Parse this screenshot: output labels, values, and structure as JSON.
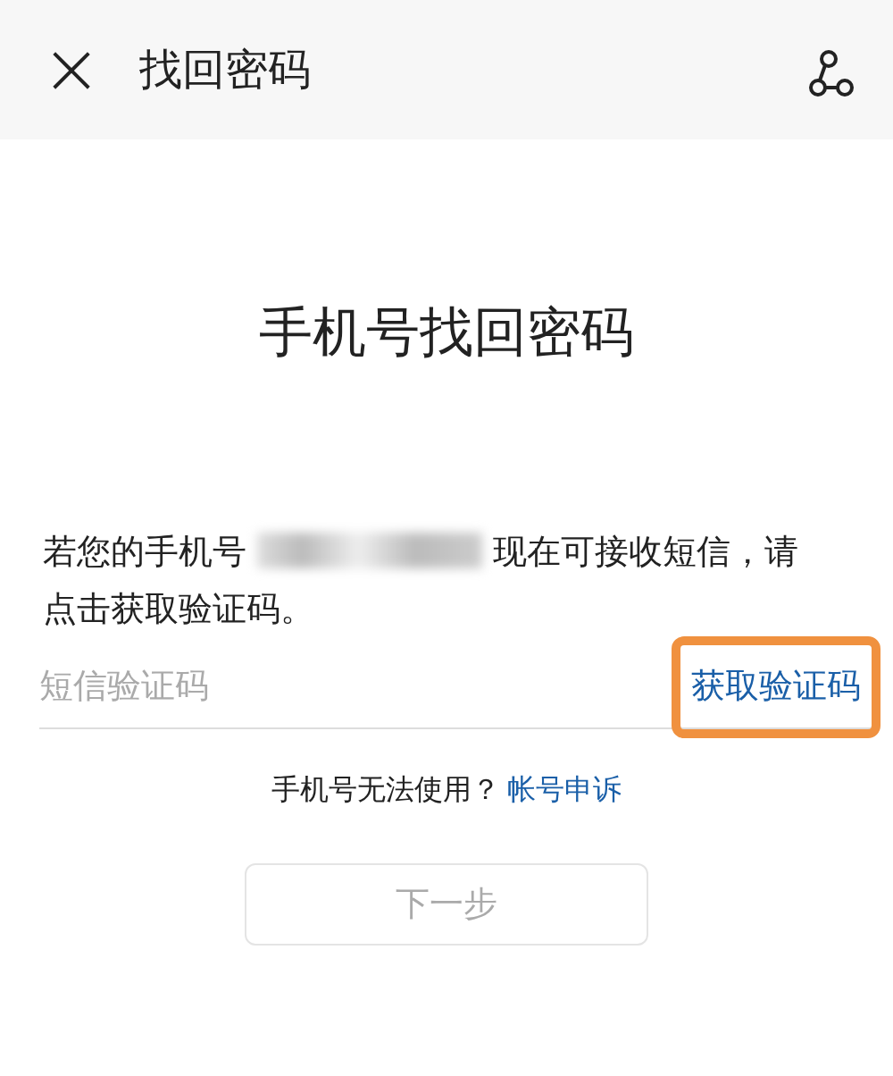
{
  "header": {
    "close_icon": "×",
    "title": "找回密码"
  },
  "heading": "手机号找回密码",
  "message": {
    "before": "若您的手机号",
    "phone_redacted": true,
    "after": [
      "现在可接收短信，请",
      "点击获取验证码。"
    ]
  },
  "code_field": {
    "placeholder": "短信验证码"
  },
  "get_code_button": {
    "label": "获取验证码",
    "highlighted": true
  },
  "help": {
    "text": "手机号无法使用？",
    "link": "帐号申诉"
  },
  "next_button": {
    "label": "下一步",
    "disabled": true
  }
}
